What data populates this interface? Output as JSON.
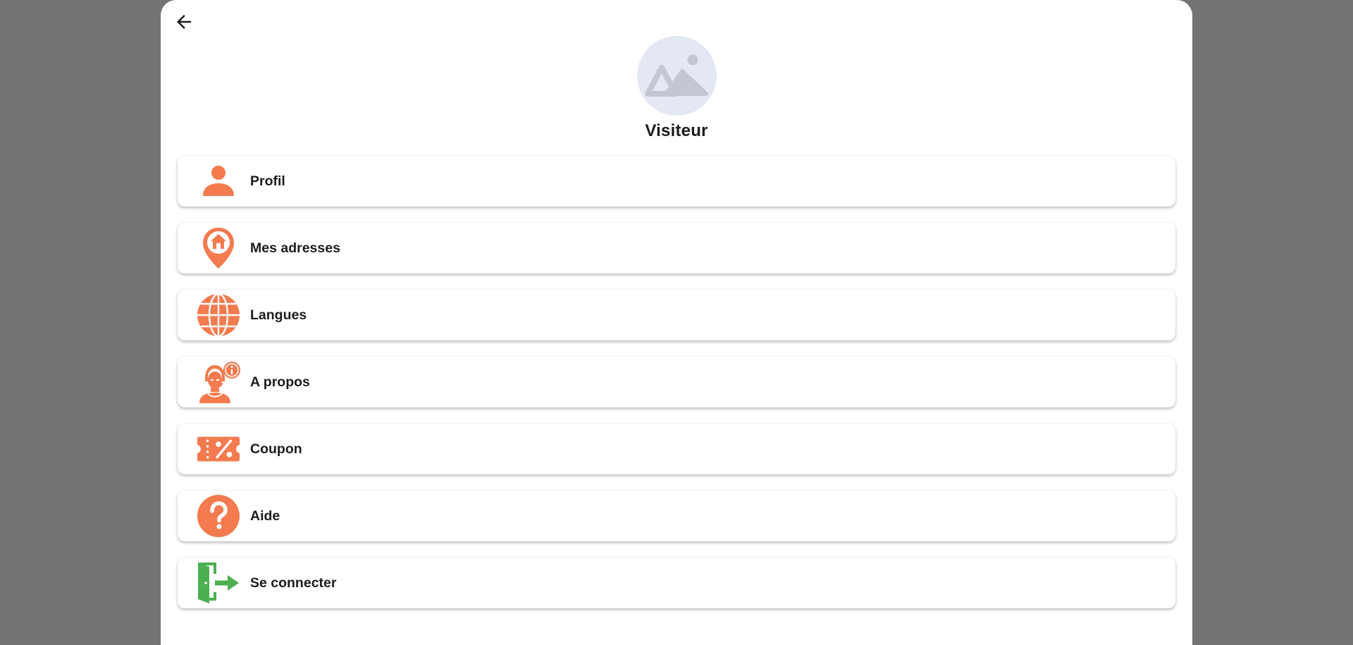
{
  "colors": {
    "background": "#747474",
    "accent": "#f37b4f",
    "login_accent": "#4caf50",
    "avatar_bg": "#e4e8f2",
    "avatar_fg": "#c3c7d1"
  },
  "header": {
    "back_icon": "arrow-left-icon"
  },
  "profile": {
    "avatar_icon": "image-placeholder-icon",
    "name": "Visiteur"
  },
  "menu": {
    "items": [
      {
        "label": "Profil",
        "icon": "user-icon"
      },
      {
        "label": "Mes adresses",
        "icon": "home-location-pin-icon"
      },
      {
        "label": "Langues",
        "icon": "globe-icon"
      },
      {
        "label": "A propos",
        "icon": "support-agent-info-icon"
      },
      {
        "label": "Coupon",
        "icon": "percent-coupon-icon"
      },
      {
        "label": "Aide",
        "icon": "question-circle-icon"
      },
      {
        "label": "Se connecter",
        "icon": "login-door-icon"
      }
    ]
  }
}
